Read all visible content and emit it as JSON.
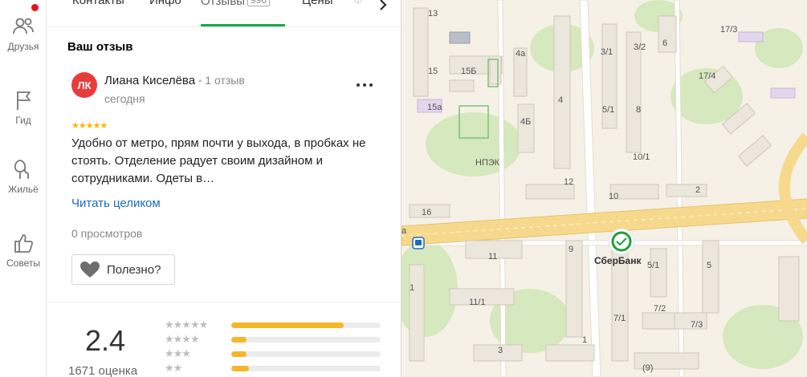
{
  "rail": {
    "items": [
      {
        "label": "Друзья",
        "icon": "friends-icon"
      },
      {
        "label": "Гид",
        "icon": "flag-icon"
      },
      {
        "label": "Жильё",
        "icon": "trees-icon"
      },
      {
        "label": "Советы",
        "icon": "thumbs-up-icon"
      }
    ]
  },
  "tabs": {
    "contacts": "Контакты",
    "info": "Инфо",
    "reviews": "Отзывы",
    "reviews_count": "996",
    "prices": "Цены",
    "cut_tab": "Ф"
  },
  "review": {
    "section_title": "Ваш отзыв",
    "avatar_initials": "ЛК",
    "author": "Лиана Киселёва",
    "author_sep": "•",
    "author_reviews": "1 отзыв",
    "date": "сегодня",
    "stars": "★★★★★",
    "rating": 5,
    "text": "Удобно от метро, прям почти у выхода, в пробках не стоять. Отделение радует своим дизайном и сотрудниками. Одеты в…",
    "read_more": "Читать целиком",
    "views": "0 просмотров",
    "useful": "Полезно?"
  },
  "summary": {
    "rating": "2.4",
    "count": "1671 оценка",
    "distribution": [
      {
        "stars": "★★★★★",
        "fraction": 0.75
      },
      {
        "stars": "★★★★",
        "fraction": 0.1
      },
      {
        "stars": "★★★",
        "fraction": 0.1
      },
      {
        "stars": "★★",
        "fraction": 0.12
      }
    ]
  },
  "map": {
    "poi": "СберБанк",
    "buildings": [
      "13",
      "15",
      "15Б",
      "15а",
      "4а",
      "4Б",
      "4",
      "НПЭК",
      "12",
      "16",
      "3/1",
      "3/2",
      "6",
      "5/1",
      "8",
      "10/1",
      "10",
      "2",
      "17/3",
      "17/4",
      "11",
      "9",
      "1",
      "11/1",
      "3",
      "5/1",
      "5",
      "7/2",
      "7/1",
      "7/3",
      "(9)",
      "1",
      "а"
    ]
  },
  "colors": {
    "accent_green": "#1aa64b",
    "link_blue": "#1b6bc4",
    "star_yellow": "#ffb400",
    "bar_yellow": "#f5b62a",
    "avatar_red": "#ea3b3b",
    "notify_red": "#e5161b"
  }
}
